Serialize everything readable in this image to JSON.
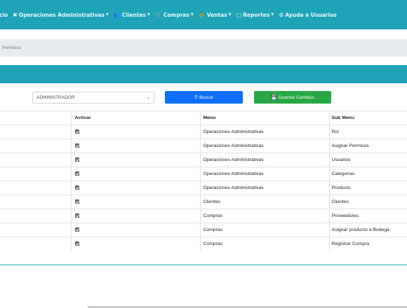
{
  "nav": {
    "items": [
      {
        "icon": "",
        "label": "cio",
        "caret": false
      },
      {
        "icon": "✖",
        "label": "Operaciones Administrativas",
        "caret": true
      },
      {
        "icon": "👥",
        "label": "Clientes",
        "caret": true
      },
      {
        "icon": "🛒",
        "label": "Compras",
        "caret": true
      },
      {
        "icon": "⛹",
        "label": "Ventas",
        "caret": true
      },
      {
        "icon": "▢",
        "label": "Reportes",
        "caret": true
      },
      {
        "icon": "⚙",
        "label": "Ayuda a Usuarios",
        "caret": false
      }
    ]
  },
  "breadcrumb": {
    "current": "Permisos"
  },
  "controls": {
    "role_selected": "ADMINISTRADOR",
    "search_label": "Buscar",
    "save_label": "Guardar Cambios"
  },
  "table": {
    "headers": [
      "",
      "Activar",
      "Menu",
      "Sub Menu"
    ],
    "rows": [
      {
        "menu": "Operaciones Administrativas",
        "submenu": "Rol",
        "checked": true
      },
      {
        "menu": "Operaciones Administrativas",
        "submenu": "Asignar Permisos",
        "checked": true
      },
      {
        "menu": "Operaciones Administrativas",
        "submenu": "Usuarios",
        "checked": true
      },
      {
        "menu": "Operaciones Administrativas",
        "submenu": "Categorias",
        "checked": true
      },
      {
        "menu": "Operaciones Administrativas",
        "submenu": "Producto",
        "checked": true
      },
      {
        "menu": "Clientes",
        "submenu": "Clientes",
        "checked": true
      },
      {
        "menu": "Compras",
        "submenu": "Proveedores",
        "checked": true
      },
      {
        "menu": "Compras",
        "submenu": "Asignar producto a Bodega",
        "checked": true
      },
      {
        "menu": "Compras",
        "submenu": "Registrar Compra",
        "checked": true
      }
    ]
  },
  "colors": {
    "nav": "#1fa3b8",
    "search_button": "#0d6efd",
    "save_button": "#28a745"
  }
}
